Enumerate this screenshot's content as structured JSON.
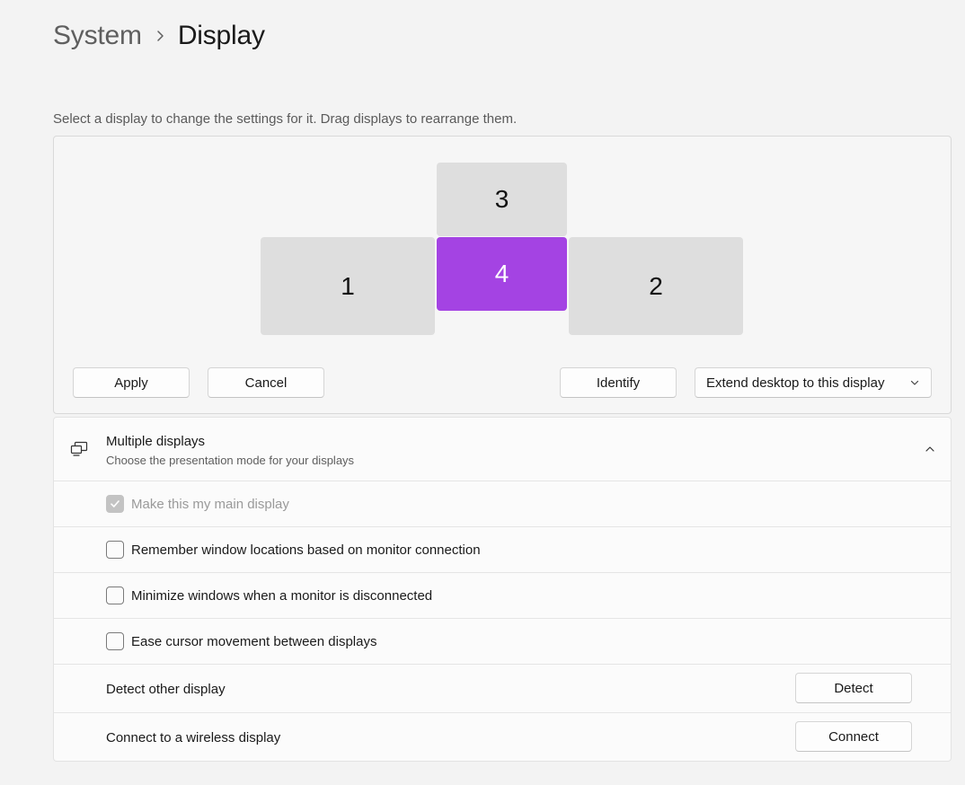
{
  "breadcrumb": {
    "parent": "System",
    "separator_icon": "chevron-right-icon",
    "current": "Display"
  },
  "instructions": "Select a display to change the settings for it. Drag displays to rearrange them.",
  "monitors": [
    {
      "number": "3",
      "selected": false
    },
    {
      "number": "1",
      "selected": false
    },
    {
      "number": "4",
      "selected": true
    },
    {
      "number": "2",
      "selected": false
    }
  ],
  "colors": {
    "selected_monitor": "#a443e3",
    "unselected_monitor": "#dedede",
    "page_background": "#f3f3f3"
  },
  "arrangement_buttons": {
    "apply": "Apply",
    "cancel": "Cancel",
    "identify": "Identify"
  },
  "display_mode": {
    "selected": "Extend desktop to this display",
    "icon": "chevron-down-icon"
  },
  "multiple_displays": {
    "title": "Multiple displays",
    "subtitle": "Choose the presentation mode for your displays",
    "icon": "multiple-displays-icon",
    "expanded": true,
    "options": [
      {
        "label": "Make this my main display",
        "checked": true,
        "disabled": true
      },
      {
        "label": "Remember window locations based on monitor connection",
        "checked": false,
        "disabled": false
      },
      {
        "label": "Minimize windows when a monitor is disconnected",
        "checked": false,
        "disabled": false
      },
      {
        "label": "Ease cursor movement between displays",
        "checked": false,
        "disabled": false
      }
    ],
    "detect": {
      "label": "Detect other display",
      "button": "Detect"
    },
    "connect": {
      "label": "Connect to a wireless display",
      "button": "Connect"
    }
  }
}
